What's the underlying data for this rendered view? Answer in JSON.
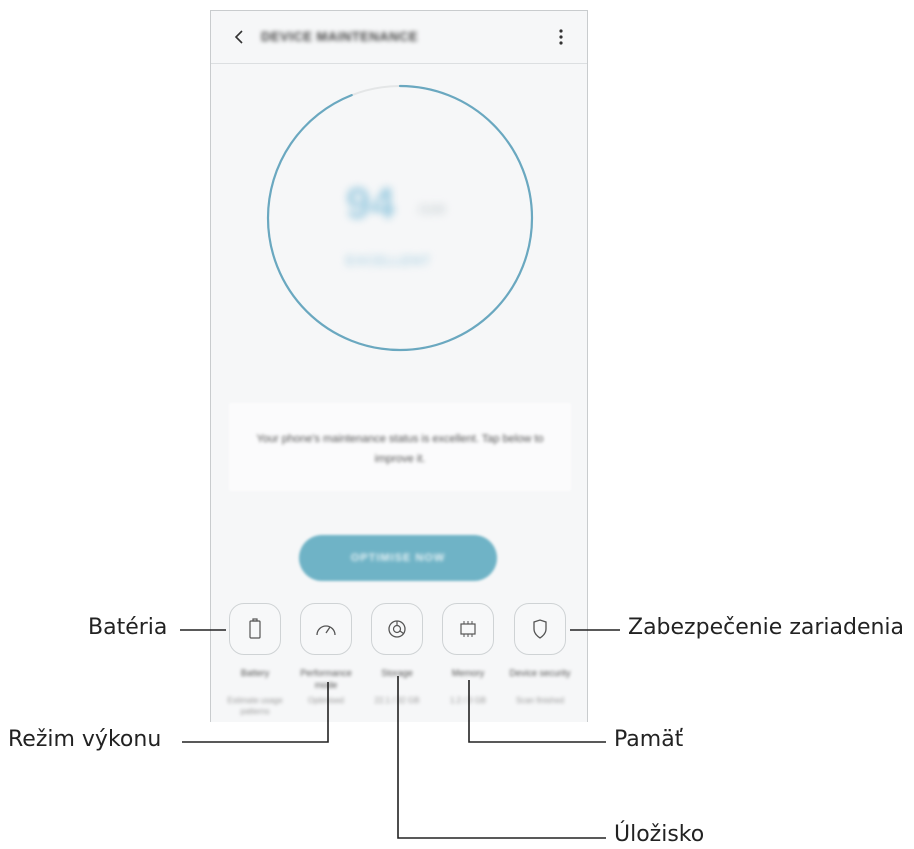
{
  "header": {
    "title": "DEVICE MAINTENANCE",
    "back_icon": "chevron-left-icon",
    "more_icon": "more-vert-icon"
  },
  "gauge": {
    "score": "94",
    "unit": "/100",
    "status": "EXCELLENT",
    "level": 0.94,
    "ring_color": "#6aa8c0"
  },
  "status_message": "Your phone's maintenance status is excellent. Tap below to improve it.",
  "optimize_button": {
    "label": "OPTIMISE NOW",
    "color": "#6fb3c6"
  },
  "tiles": [
    {
      "label": "Battery",
      "sub": "Estimate usage patterns",
      "icon": "battery-icon"
    },
    {
      "label": "Performance mode",
      "sub": "Optimised",
      "icon": "speedometer-icon"
    },
    {
      "label": "Storage",
      "sub": "22.1 / 32 GB",
      "icon": "pie-chart-icon"
    },
    {
      "label": "Memory",
      "sub": "1.2 / 3 GB",
      "icon": "memory-chip-icon"
    },
    {
      "label": "Device security",
      "sub": "Scan finished",
      "icon": "shield-icon"
    }
  ],
  "callouts": {
    "battery": "Batéria",
    "performance": "Režim výkonu",
    "storage": "Úložisko",
    "memory": "Pamäť",
    "security": "Zabezpečenie zariadenia"
  }
}
